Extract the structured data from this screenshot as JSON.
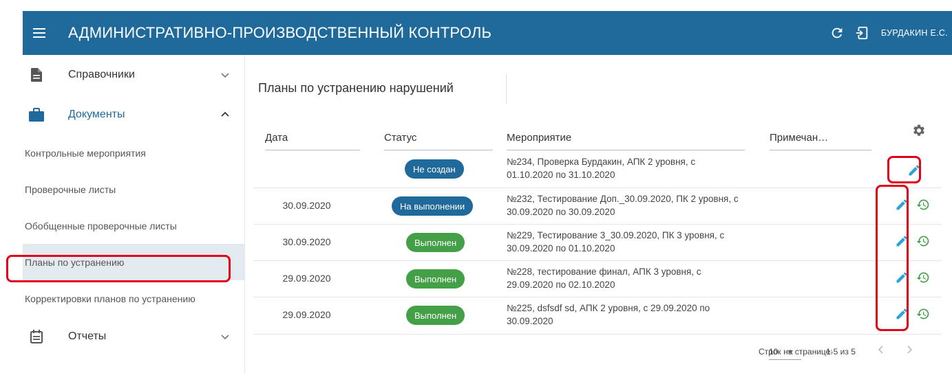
{
  "header": {
    "title": "АДМИНИСТРАТИВНО-ПРОИЗВОДСТВЕННЫЙ КОНТРОЛЬ",
    "user": "БУРДАКИН Е.С.",
    "color": "#1f6a9b"
  },
  "sidebar": {
    "groups": [
      {
        "label": "Справочники",
        "icon": "document-icon",
        "expanded": false
      },
      {
        "label": "Документы",
        "icon": "briefcase-icon",
        "expanded": true
      },
      {
        "label": "Отчеты",
        "icon": "calendar-list-icon",
        "expanded": false
      }
    ],
    "documents_items": [
      {
        "label": "Контрольные мероприятия"
      },
      {
        "label": "Проверочные листы"
      },
      {
        "label": "Обобщенные проверочные листы"
      },
      {
        "label": "Планы по устранению",
        "selected": true
      },
      {
        "label": "Корректировки планов по устранению"
      }
    ]
  },
  "main": {
    "title": "Планы по устранению нарушений",
    "columns": [
      "Дата",
      "Статус",
      "Мероприятие",
      "Примечан…"
    ],
    "rows": [
      {
        "date": "",
        "status": "Не создан",
        "status_color": "#1f6a9b",
        "event": "№234, Проверка Бурдакин, АПК 2 уровня, с 01.10.2020 по 31.10.2020",
        "history": false
      },
      {
        "date": "30.09.2020",
        "status": "На выполнении",
        "status_color": "#1f6a9b",
        "event": "№232, Тестирование Доп._30.09.2020, ПК 2 уровня, с 30.09.2020 по 30.09.2020",
        "history": true
      },
      {
        "date": "30.09.2020",
        "status": "Выполнен",
        "status_color": "#43a047",
        "event": "№229, Тестирование 3_30.09.2020, ПК 3 уровня, с 30.09.2020 по 01.10.2020",
        "history": true
      },
      {
        "date": "29.09.2020",
        "status": "Выполнен",
        "status_color": "#43a047",
        "event": "№228, тестирование финал, АПК 3 уровня, с 29.09.2020 по 02.10.2020",
        "history": true
      },
      {
        "date": "29.09.2020",
        "status": "Выполнен",
        "status_color": "#43a047",
        "event": "№225, dsfsdf sd, АПК 2 уровня, с 29.09.2020 по 30.09.2020",
        "history": true
      }
    ],
    "pagination": {
      "rows_per_page_label": "Строк на странице:",
      "rows_per_page": "10",
      "range": "1-5 из 5"
    }
  }
}
